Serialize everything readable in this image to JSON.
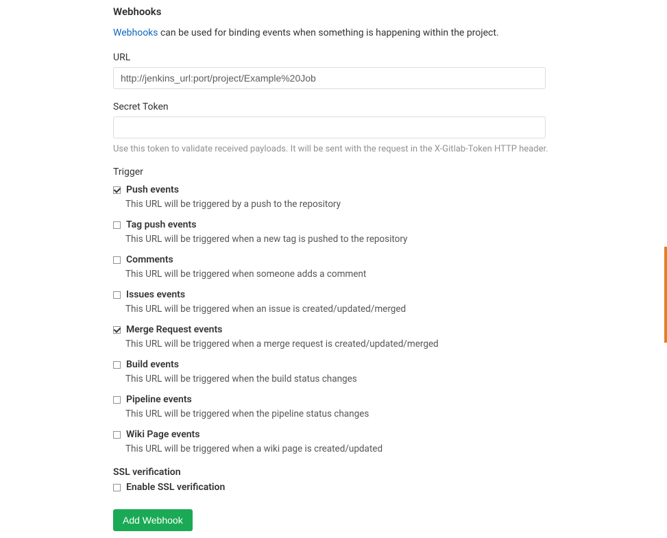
{
  "page_title": "Webhooks",
  "description_link_text": "Webhooks",
  "description_text": " can be used for binding events when something is happening within the project.",
  "url": {
    "label": "URL",
    "value": "http://jenkins_url:port/project/Example%20Job"
  },
  "secret_token": {
    "label": "Secret Token",
    "value": "",
    "help": "Use this token to validate received payloads. It will be sent with the request in the X-Gitlab-Token HTTP header."
  },
  "trigger": {
    "label": "Trigger",
    "items": [
      {
        "checked": true,
        "label": "Push events",
        "desc": "This URL will be triggered by a push to the repository"
      },
      {
        "checked": false,
        "label": "Tag push events",
        "desc": "This URL will be triggered when a new tag is pushed to the repository"
      },
      {
        "checked": false,
        "label": "Comments",
        "desc": "This URL will be triggered when someone adds a comment"
      },
      {
        "checked": false,
        "label": "Issues events",
        "desc": "This URL will be triggered when an issue is created/updated/merged"
      },
      {
        "checked": true,
        "label": "Merge Request events",
        "desc": "This URL will be triggered when a merge request is created/updated/merged"
      },
      {
        "checked": false,
        "label": "Build events",
        "desc": "This URL will be triggered when the build status changes"
      },
      {
        "checked": false,
        "label": "Pipeline events",
        "desc": "This URL will be triggered when the pipeline status changes"
      },
      {
        "checked": false,
        "label": "Wiki Page events",
        "desc": "This URL will be triggered when a wiki page is created/updated"
      }
    ]
  },
  "ssl": {
    "label": "SSL verification",
    "enable_label": "Enable SSL verification",
    "checked": false
  },
  "add_button": "Add Webhook"
}
